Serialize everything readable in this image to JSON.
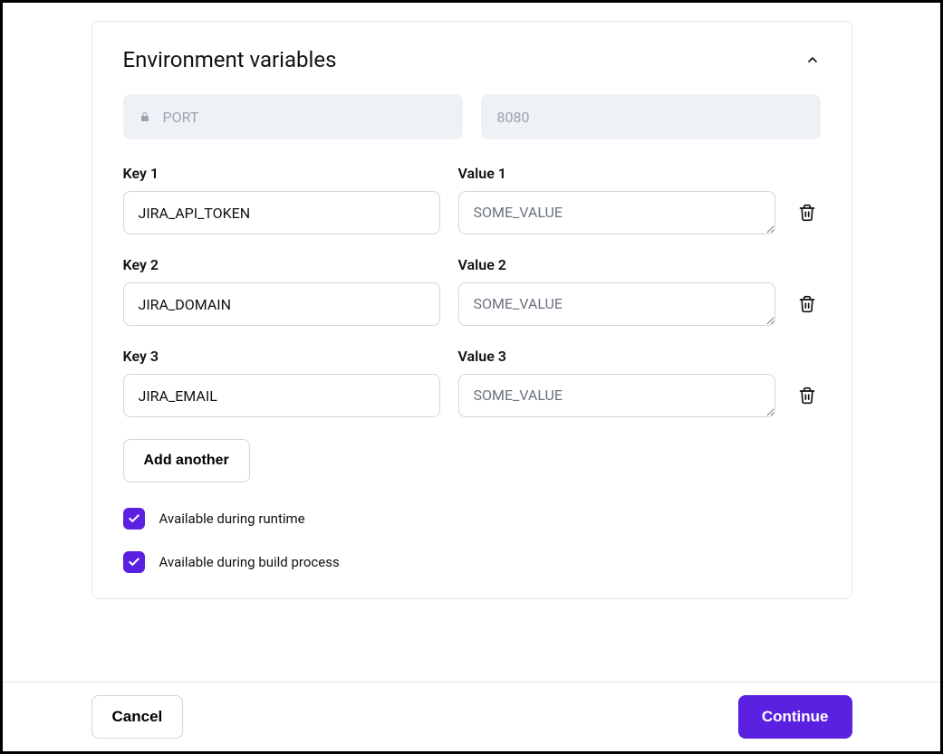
{
  "card": {
    "title": "Environment variables",
    "example_key": "PORT",
    "example_value": "8080"
  },
  "vars": [
    {
      "key_label": "Key 1",
      "value_label": "Value 1",
      "key": "JIRA_API_TOKEN",
      "value": "SOME_VALUE"
    },
    {
      "key_label": "Key 2",
      "value_label": "Value 2",
      "key": "JIRA_DOMAIN",
      "value": "SOME_VALUE"
    },
    {
      "key_label": "Key 3",
      "value_label": "Value 3",
      "key": "JIRA_EMAIL",
      "value": "SOME_VALUE"
    }
  ],
  "add_another_label": "Add another",
  "checkboxes": {
    "runtime": "Available during runtime",
    "build": "Available during build process"
  },
  "footer": {
    "cancel": "Cancel",
    "continue": "Continue"
  }
}
